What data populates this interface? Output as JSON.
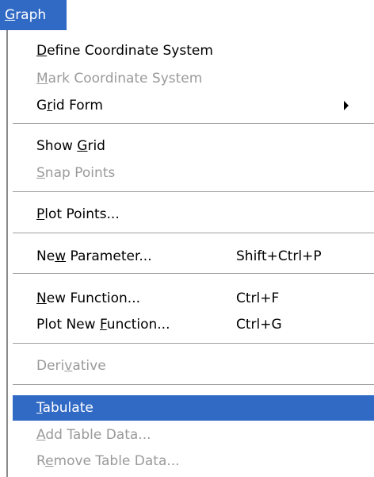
{
  "menu_title": "Graph",
  "items": {
    "define_coordinate_system": {
      "label": "Define Coordinate System",
      "underline": "D",
      "enabled": true
    },
    "mark_coordinate_system": {
      "label": "Mark Coordinate System",
      "underline": "M",
      "enabled": false
    },
    "grid_form": {
      "label": "Grid Form",
      "underline": "r",
      "enabled": true,
      "submenu": true
    },
    "show_grid": {
      "label": "Show Grid",
      "underline": "G",
      "enabled": true
    },
    "snap_points": {
      "label": "Snap Points",
      "underline": "S",
      "enabled": false
    },
    "plot_points": {
      "label": "Plot Points...",
      "underline": "P",
      "enabled": true
    },
    "new_parameter": {
      "label": "New Parameter...",
      "underline": "w",
      "shortcut": "Shift+Ctrl+P",
      "enabled": true
    },
    "new_function": {
      "label": "New Function...",
      "underline": "N",
      "shortcut": "Ctrl+F",
      "enabled": true
    },
    "plot_new_function": {
      "label": "Plot New Function...",
      "underline": "F",
      "shortcut": "Ctrl+G",
      "enabled": true
    },
    "derivative": {
      "label": "Derivative",
      "underline": "v",
      "enabled": false
    },
    "tabulate": {
      "label": "Tabulate",
      "underline": "T",
      "enabled": true,
      "highlighted": true
    },
    "add_table_data": {
      "label": "Add Table Data...",
      "underline": "A",
      "enabled": false
    },
    "remove_table_data": {
      "label": "Remove Table Data...",
      "underline": "e",
      "enabled": false
    }
  },
  "colors": {
    "highlight": "#316ac5",
    "disabled_text": "#9a9a9a",
    "separator": "#a0a0a0"
  }
}
